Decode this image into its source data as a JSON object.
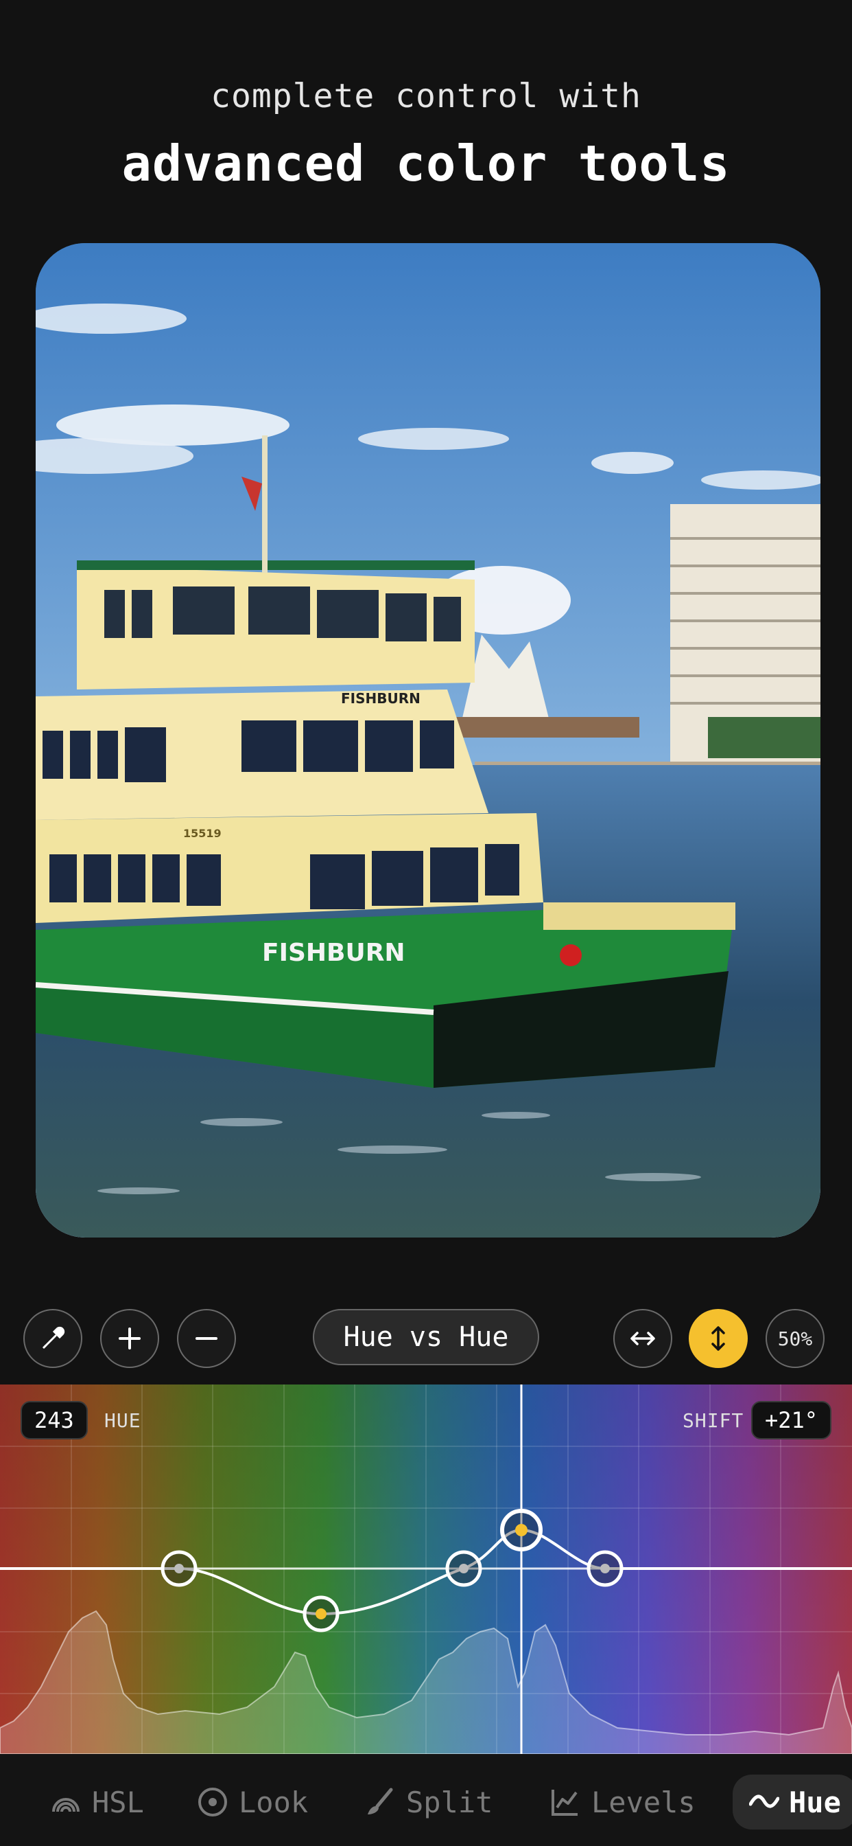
{
  "header": {
    "subtitle": "complete control with",
    "title": "advanced color tools"
  },
  "photo": {
    "hull_text": "FISHBURN",
    "cabin_text": "FISHBURN",
    "number_text": "15519"
  },
  "toolbar": {
    "eyedropper_icon": "eyedropper-icon",
    "add_icon": "plus-icon",
    "remove_icon": "minus-icon",
    "mode_label": "Hue vs Hue",
    "horizontal_icon": "horizontal-arrows-icon",
    "vertical_icon": "vertical-arrows-icon",
    "zoom_label": "50%",
    "accent_color": "#f5c02e"
  },
  "curve": {
    "hue_value": "243",
    "hue_label": "HUE",
    "shift_label": "SHIFT",
    "shift_value": "+21°"
  },
  "tabs": [
    {
      "label": "HSL",
      "icon": "rainbow-icon"
    },
    {
      "label": "Look",
      "icon": "target-icon"
    },
    {
      "label": "Split",
      "icon": "brush-icon"
    },
    {
      "label": "Levels",
      "icon": "chart-icon"
    },
    {
      "label": "Hue",
      "icon": "curve-icon",
      "active": true
    }
  ]
}
